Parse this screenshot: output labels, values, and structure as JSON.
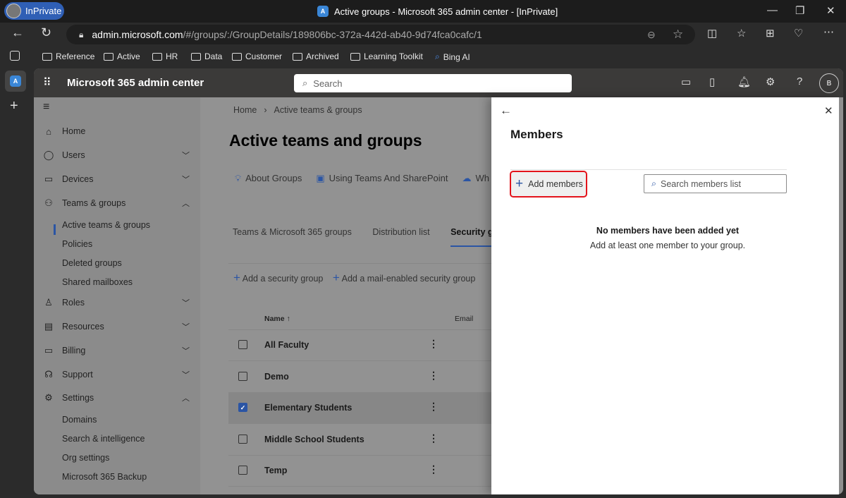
{
  "browser": {
    "profile": "InPrivate",
    "window_title": "Active groups - Microsoft 365 admin center - [InPrivate]",
    "url_host": "admin.microsoft.com",
    "url_path": "/#/groups/:/GroupDetails/189806bc-372a-442d-ab40-9d74fca0cafc/1",
    "bookmarks": [
      "Reference",
      "Active",
      "HR",
      "Data",
      "Customer",
      "Archived",
      "Learning Toolkit",
      "Bing AI"
    ]
  },
  "app": {
    "title": "Microsoft 365 admin center",
    "search_placeholder": "Search",
    "avatar": "B"
  },
  "sidebar": {
    "items": [
      {
        "label": "Home",
        "icon": "home-icon"
      },
      {
        "label": "Users",
        "icon": "user-icon",
        "chev": "down"
      },
      {
        "label": "Devices",
        "icon": "device-icon",
        "chev": "down"
      },
      {
        "label": "Teams & groups",
        "icon": "teams-icon",
        "chev": "up"
      },
      {
        "label": "Active teams & groups",
        "sub": true,
        "active": true
      },
      {
        "label": "Policies",
        "sub": true
      },
      {
        "label": "Deleted groups",
        "sub": true
      },
      {
        "label": "Shared mailboxes",
        "sub": true
      },
      {
        "label": "Roles",
        "icon": "roles-icon",
        "chev": "down"
      },
      {
        "label": "Resources",
        "icon": "resources-icon",
        "chev": "down"
      },
      {
        "label": "Billing",
        "icon": "billing-icon",
        "chev": "down"
      },
      {
        "label": "Support",
        "icon": "support-icon",
        "chev": "down"
      },
      {
        "label": "Settings",
        "icon": "gear-icon",
        "chev": "up"
      },
      {
        "label": "Domains",
        "sub": true
      },
      {
        "label": "Search & intelligence",
        "sub": true
      },
      {
        "label": "Org settings",
        "sub": true
      },
      {
        "label": "Microsoft 365 Backup",
        "sub": true
      }
    ]
  },
  "main": {
    "breadcrumb": [
      "Home",
      "Active teams & groups"
    ],
    "title": "Active teams and groups",
    "links": [
      "About Groups",
      "Using Teams And SharePoint",
      "Wh"
    ],
    "tabs": [
      "Teams & Microsoft 365 groups",
      "Distribution list",
      "Security grou"
    ],
    "actions": [
      "Add a security group",
      "Add a mail-enabled security group"
    ],
    "columns": [
      "Name ↑",
      "Email"
    ],
    "rows": [
      {
        "name": "All Faculty",
        "checked": false
      },
      {
        "name": "Demo",
        "checked": false
      },
      {
        "name": "Elementary Students",
        "checked": true
      },
      {
        "name": "Middle School Students",
        "checked": false
      },
      {
        "name": "Temp",
        "checked": false
      }
    ]
  },
  "panel": {
    "title": "Members",
    "add_label": "Add members",
    "search_placeholder": "Search members list",
    "empty_title": "No members have been added yet",
    "empty_text": "Add at least one member to your group.",
    "highlight_color": "#e3131b"
  },
  "colors": {
    "accent": "#2b55a4"
  }
}
